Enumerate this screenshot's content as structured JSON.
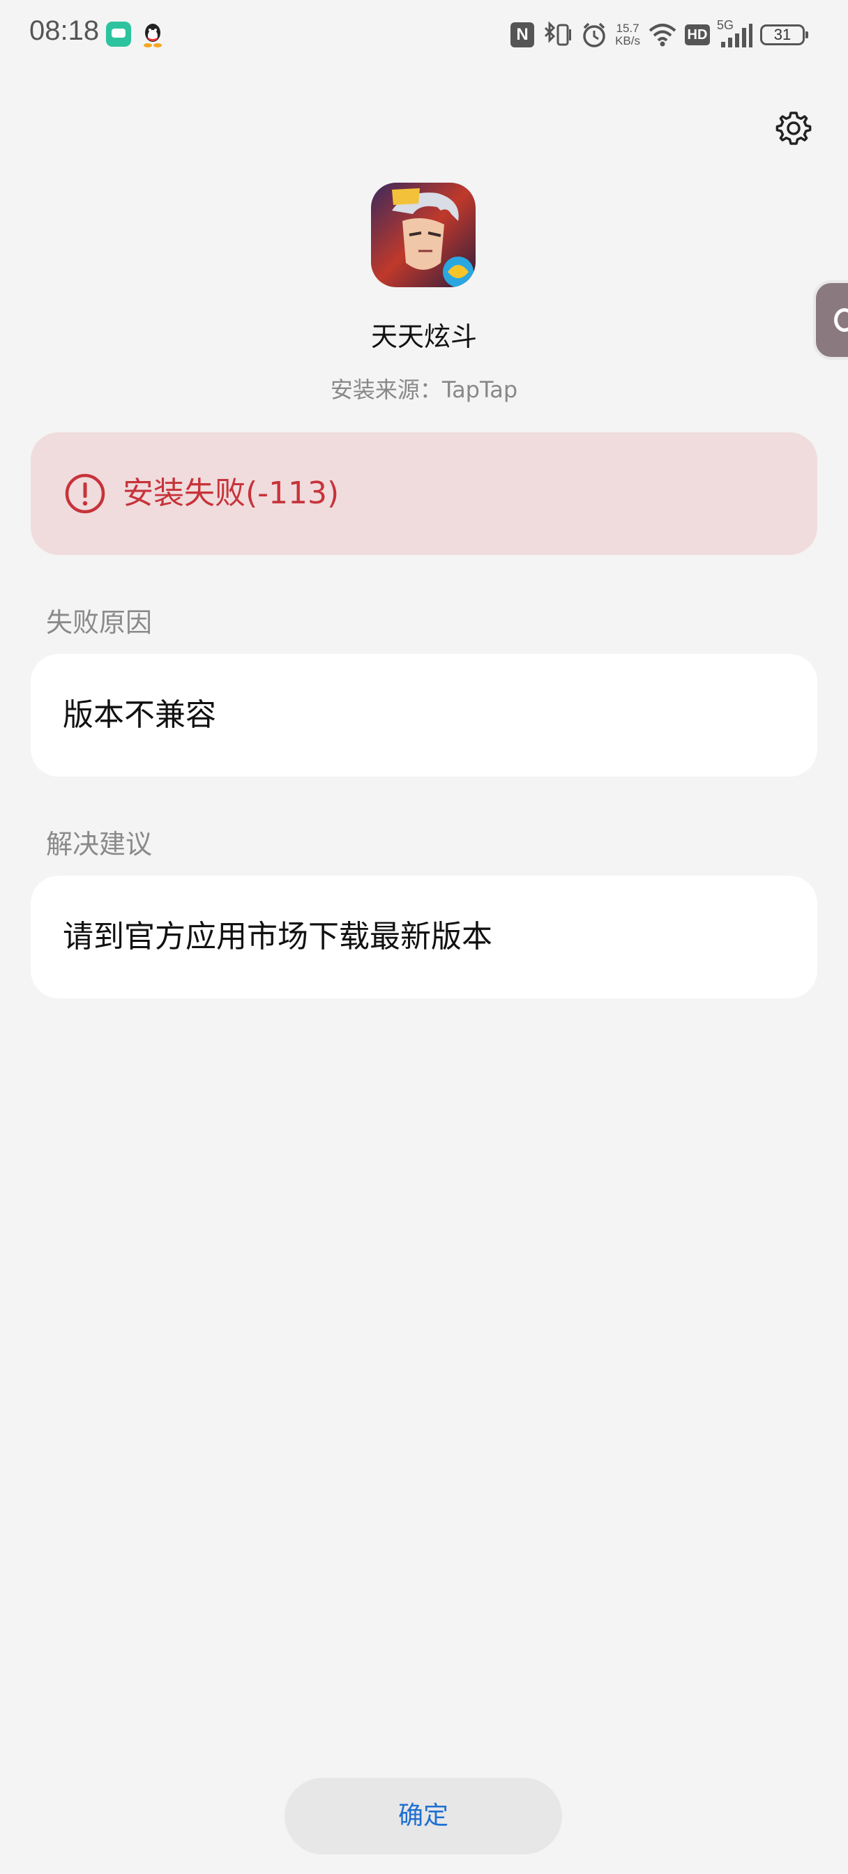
{
  "status_bar": {
    "time": "08:18",
    "net_speed_value": "15.7",
    "net_speed_unit": "KB/s",
    "hd_label": "HD",
    "network_label": "5G",
    "battery_level": "31",
    "nfc_label": "N"
  },
  "app": {
    "name": "天天炫斗",
    "source": "安装来源：TapTap"
  },
  "error": {
    "message": "安装失败(-113)",
    "color": "#c7333a"
  },
  "failure_reason": {
    "label": "失败原因",
    "text": "版本不兼容"
  },
  "suggestion": {
    "label": "解决建议",
    "text": "请到官方应用市场下载最新版本"
  },
  "actions": {
    "confirm_label": "确定"
  },
  "colors": {
    "accent": "#1f6fd1",
    "error_bg": "#f0dcdd",
    "page_bg": "#f4f4f4"
  }
}
